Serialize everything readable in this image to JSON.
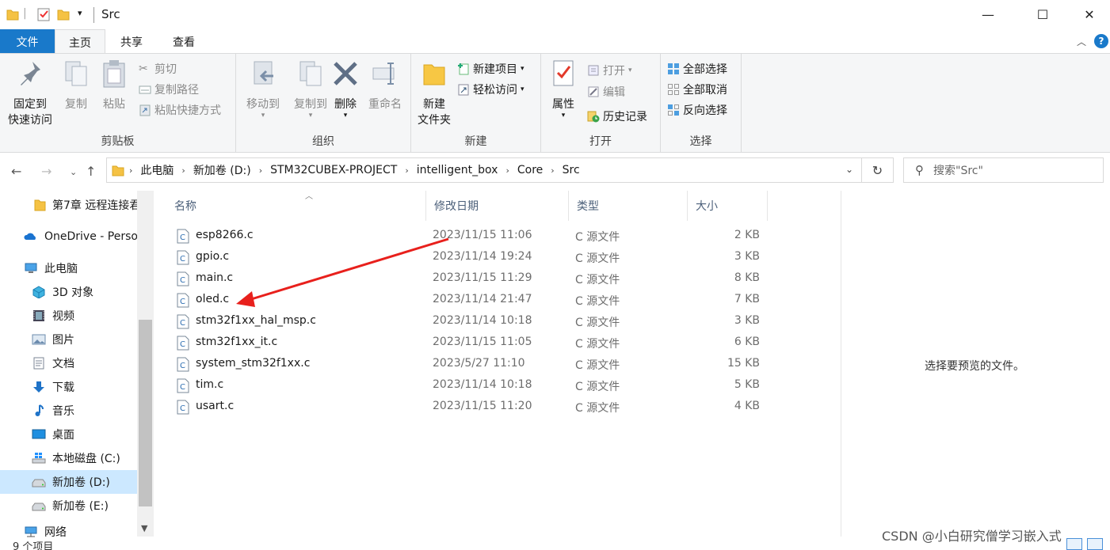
{
  "window": {
    "title": "Src",
    "minimize_glyph": "—",
    "maximize_glyph": "☐",
    "close_glyph": "✕"
  },
  "ribbon_tabs": {
    "file": "文件",
    "home": "主页",
    "share": "共享",
    "view": "查看",
    "help_glyph": "?"
  },
  "ribbon": {
    "clipboard": {
      "label": "剪贴板",
      "pin_line1": "固定到",
      "pin_line2": "快速访问",
      "copy": "复制",
      "paste": "粘贴",
      "cut": "剪切",
      "copy_path": "复制路径",
      "paste_shortcut": "粘贴快捷方式"
    },
    "organize": {
      "label": "组织",
      "move_to": "移动到",
      "copy_to": "复制到",
      "delete": "删除",
      "rename": "重命名"
    },
    "new": {
      "label": "新建",
      "new_folder_line1": "新建",
      "new_folder_line2": "文件夹",
      "new_item": "新建项目",
      "easy_access": "轻松访问"
    },
    "open": {
      "label": "打开",
      "properties": "属性",
      "open": "打开",
      "edit": "编辑",
      "history": "历史记录"
    },
    "select": {
      "label": "选择",
      "select_all": "全部选择",
      "select_none": "全部取消",
      "invert": "反向选择"
    }
  },
  "address": {
    "breadcrumbs": [
      "此电脑",
      "新加卷 (D:)",
      "STM32CUBEX-PROJECT",
      "intelligent_box",
      "Core",
      "Src"
    ],
    "search_placeholder": "搜索\"Src\""
  },
  "nav_pane": {
    "items": [
      {
        "label": "第7章 远程连接君",
        "icon": "folder-icon"
      },
      {
        "label": "OneDrive - Perso",
        "icon": "onedrive-icon"
      },
      {
        "label": "此电脑",
        "icon": "computer-icon"
      },
      {
        "label": "3D 对象",
        "icon": "3d-objects-icon"
      },
      {
        "label": "视频",
        "icon": "video-icon"
      },
      {
        "label": "图片",
        "icon": "pictures-icon"
      },
      {
        "label": "文档",
        "icon": "documents-icon"
      },
      {
        "label": "下载",
        "icon": "download-icon"
      },
      {
        "label": "音乐",
        "icon": "music-icon"
      },
      {
        "label": "桌面",
        "icon": "desktop-icon"
      },
      {
        "label": "本地磁盘 (C:)",
        "icon": "windows-drive-icon"
      },
      {
        "label": "新加卷 (D:)",
        "icon": "drive-icon",
        "selected": true
      },
      {
        "label": "新加卷 (E:)",
        "icon": "drive-icon"
      },
      {
        "label": "网络",
        "icon": "network-icon"
      }
    ]
  },
  "file_list": {
    "columns": {
      "name": "名称",
      "date": "修改日期",
      "type": "类型",
      "size": "大小"
    },
    "rows": [
      {
        "name": "esp8266.c",
        "date": "2023/11/15 11:06",
        "type": "C 源文件",
        "size": "2 KB"
      },
      {
        "name": "gpio.c",
        "date": "2023/11/14 19:24",
        "type": "C 源文件",
        "size": "3 KB"
      },
      {
        "name": "main.c",
        "date": "2023/11/15 11:29",
        "type": "C 源文件",
        "size": "8 KB"
      },
      {
        "name": "oled.c",
        "date": "2023/11/14 21:47",
        "type": "C 源文件",
        "size": "7 KB"
      },
      {
        "name": "stm32f1xx_hal_msp.c",
        "date": "2023/11/14 10:18",
        "type": "C 源文件",
        "size": "3 KB"
      },
      {
        "name": "stm32f1xx_it.c",
        "date": "2023/11/15 11:05",
        "type": "C 源文件",
        "size": "6 KB"
      },
      {
        "name": "system_stm32f1xx.c",
        "date": "2023/5/27 11:10",
        "type": "C 源文件",
        "size": "15 KB"
      },
      {
        "name": "tim.c",
        "date": "2023/11/14 10:18",
        "type": "C 源文件",
        "size": "5 KB"
      },
      {
        "name": "usart.c",
        "date": "2023/11/15 11:20",
        "type": "C 源文件",
        "size": "4 KB"
      }
    ]
  },
  "preview": {
    "message": "选择要预览的文件。"
  },
  "status": {
    "item_count": "9 个项目"
  },
  "watermark": "CSDN @小白研究僧学习嵌入式",
  "annotation": {
    "arrow_color": "#e8201c"
  },
  "colors": {
    "accent": "#1979ca",
    "selection": "#cce8ff"
  }
}
